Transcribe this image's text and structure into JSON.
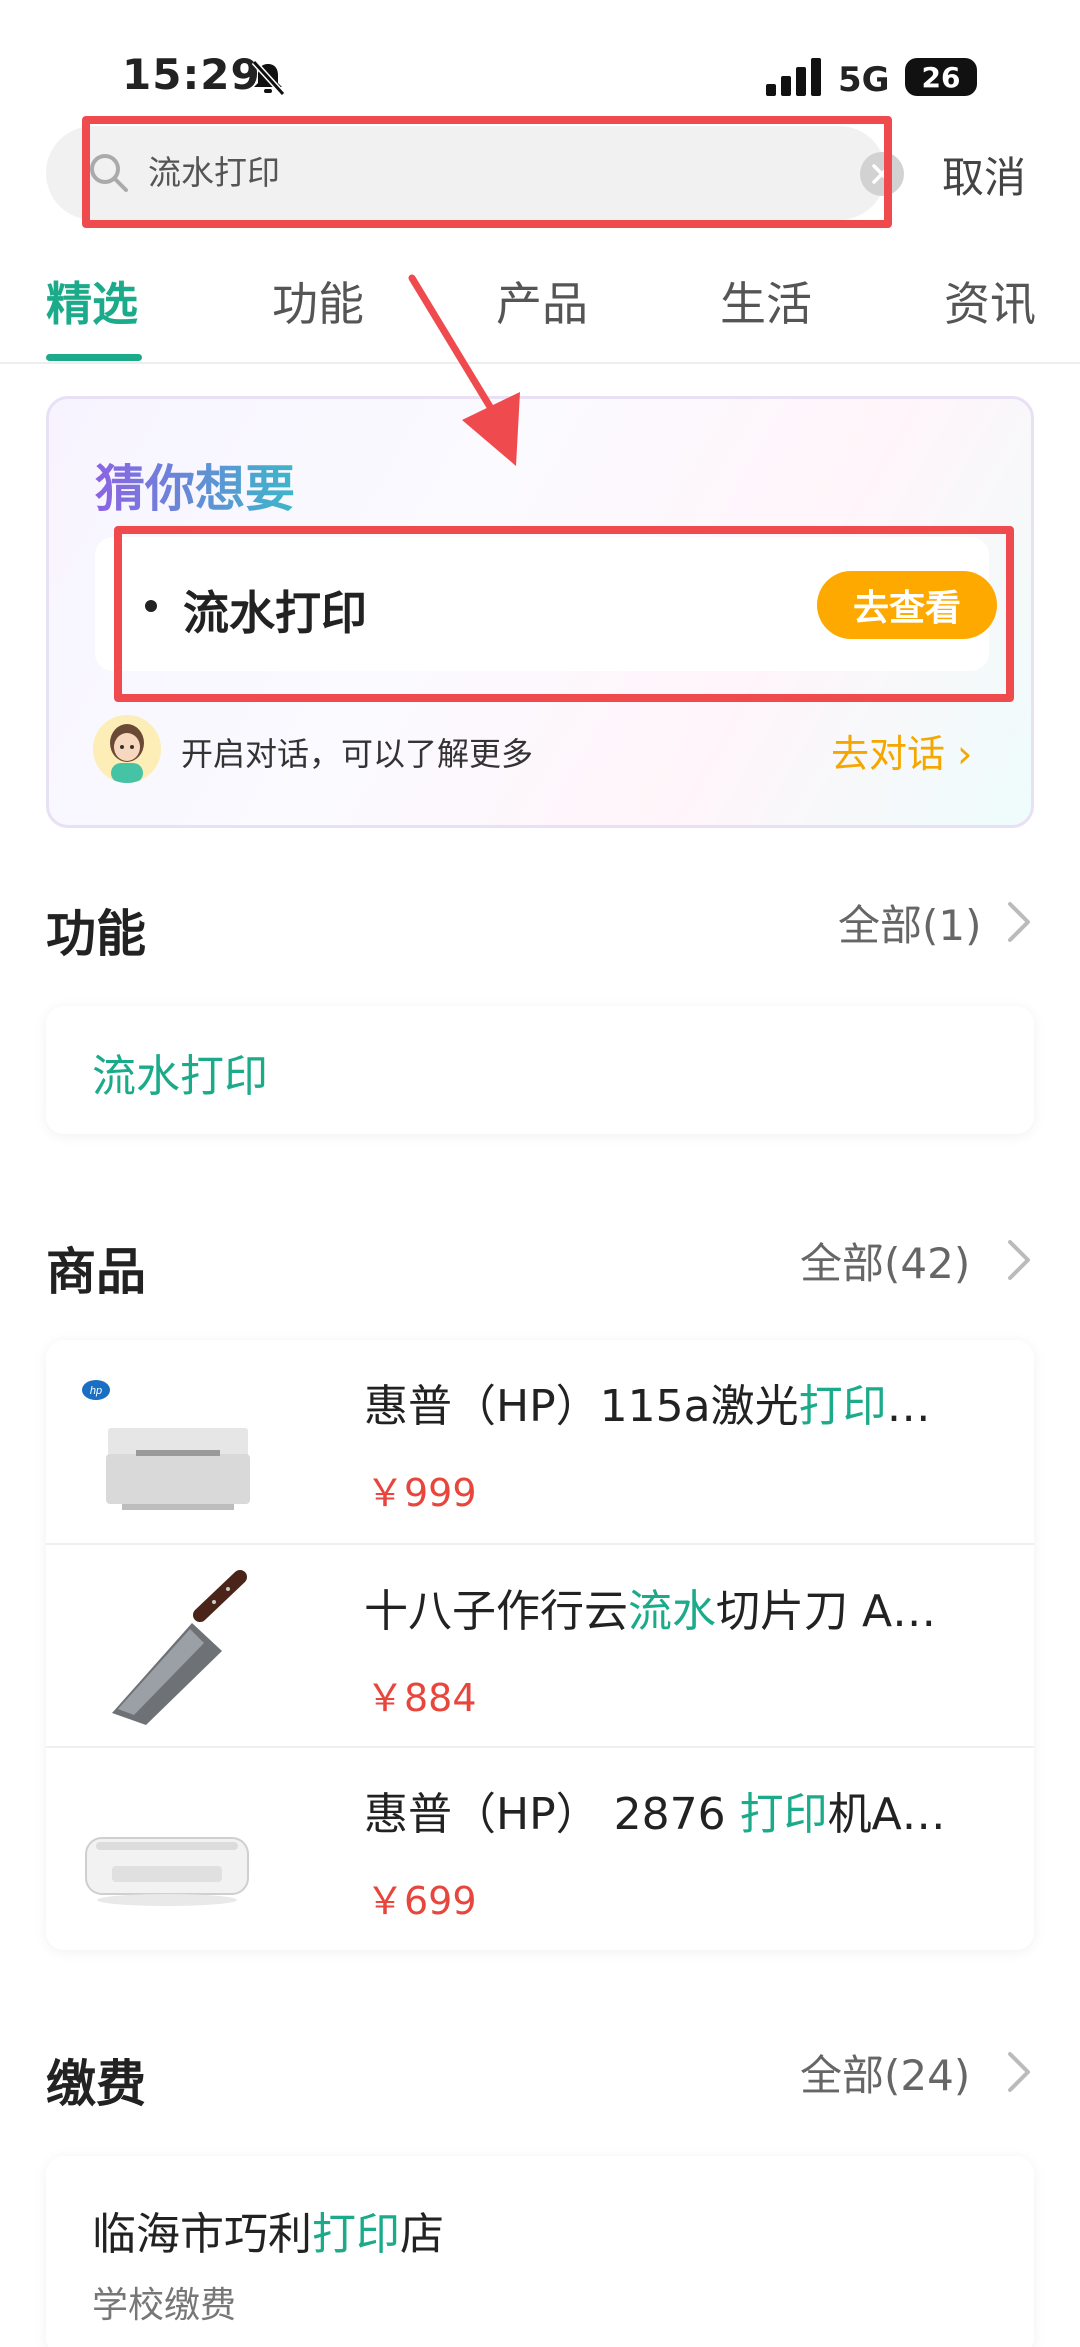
{
  "status_bar": {
    "time": "15:29",
    "network": "5G",
    "battery": "26"
  },
  "search": {
    "query": "流水打印",
    "cancel_label": "取消"
  },
  "tabs": [
    {
      "label": "精选",
      "active": true
    },
    {
      "label": "功能",
      "active": false
    },
    {
      "label": "产品",
      "active": false
    },
    {
      "label": "生活",
      "active": false
    },
    {
      "label": "资讯",
      "active": false
    }
  ],
  "guess": {
    "title": "猜你想要",
    "item_label": "流水打印",
    "item_button": "去查看",
    "chat_hint": "开启对话，可以了解更多",
    "chat_link": "去对话 ›"
  },
  "functions": {
    "title": "功能",
    "all_label": "全部(1)",
    "items": [
      "流水打印"
    ]
  },
  "products": {
    "title": "商品",
    "all_label": "全部(42)",
    "items": [
      {
        "name_pre": "惠普（HP）115a激光",
        "name_hl": "打印",
        "name_post": "…",
        "price": "￥999",
        "image": "laser-printer-image"
      },
      {
        "name_pre": "十八子作行云",
        "name_hl": "流水",
        "name_post": "切片刀 A…",
        "price": "￥884",
        "image": "kitchen-knife-image"
      },
      {
        "name_pre": "惠普（HP） 2876 ",
        "name_hl": "打印",
        "name_post": "机A…",
        "price": "￥699",
        "image": "inkjet-printer-image"
      }
    ]
  },
  "fees": {
    "title": "缴费",
    "all_label": "全部(24)",
    "items": [
      {
        "name_pre": "临海市巧利",
        "name_hl": "打印",
        "name_post": "店",
        "sub": "学校缴费"
      }
    ]
  },
  "colors": {
    "accent": "#1bab8a",
    "price": "#e8463d",
    "button": "#fea900",
    "annotation": "#ef4b4f"
  },
  "icons": [
    "bell-muted-icon",
    "signal-icon",
    "battery-icon",
    "search-icon",
    "clear-icon",
    "chevron-right-icon",
    "annotation-arrow"
  ]
}
